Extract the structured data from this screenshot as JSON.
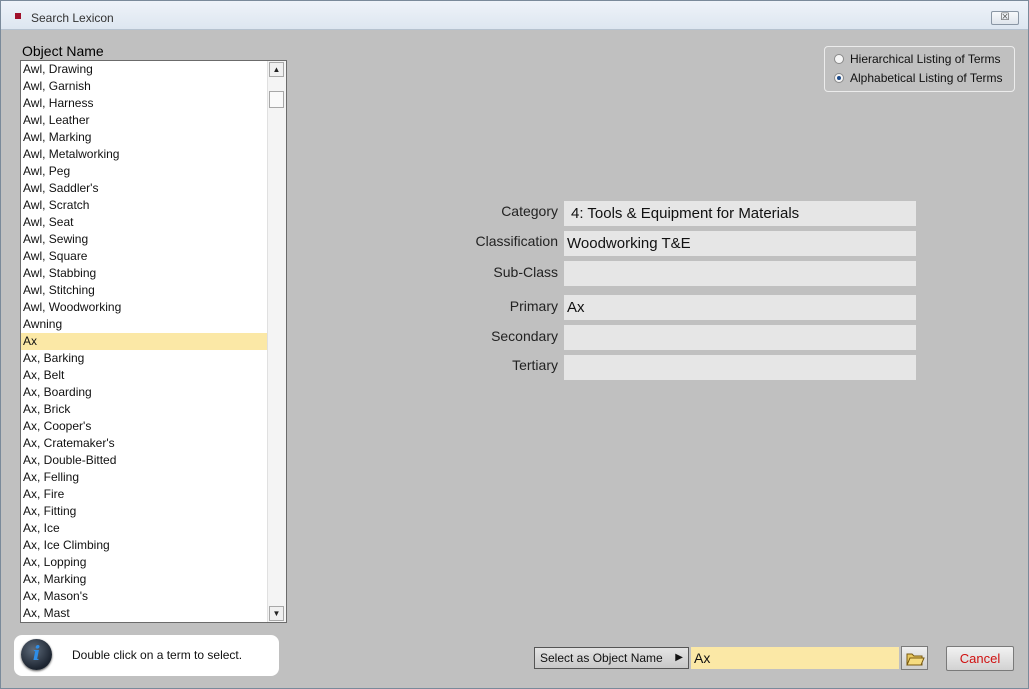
{
  "window": {
    "title": "Search Lexicon",
    "close_label": "☒"
  },
  "list": {
    "header": "Object Name",
    "items": [
      "Awl, Drawing",
      "Awl, Garnish",
      "Awl, Harness",
      "Awl, Leather",
      "Awl, Marking",
      "Awl, Metalworking",
      "Awl, Peg",
      "Awl, Saddler's",
      "Awl, Scratch",
      "Awl, Seat",
      "Awl, Sewing",
      "Awl, Square",
      "Awl, Stabbing",
      "Awl, Stitching",
      "Awl, Woodworking",
      "Awning",
      "Ax",
      "Ax, Barking",
      "Ax, Belt",
      "Ax, Boarding",
      "Ax, Brick",
      "Ax, Cooper's",
      "Ax, Cratemaker's",
      "Ax, Double-Bitted",
      "Ax, Felling",
      "Ax, Fire",
      "Ax, Fitting",
      "Ax, Ice",
      "Ax, Ice Climbing",
      "Ax, Lopping",
      "Ax, Marking",
      "Ax, Mason's",
      "Ax, Mast"
    ],
    "selected_item": "Ax"
  },
  "view_mode": {
    "options": [
      "Hierarchical Listing of Terms",
      "Alphabetical Listing of Terms"
    ],
    "selected": "Alphabetical Listing of Terms"
  },
  "fields": {
    "category": {
      "label": "Category",
      "value": "4: Tools & Equipment for Materials"
    },
    "classification": {
      "label": "Classification",
      "value": "Woodworking T&E"
    },
    "subclass": {
      "label": "Sub-Class",
      "value": ""
    },
    "primary": {
      "label": "Primary",
      "value": "Ax"
    },
    "secondary": {
      "label": "Secondary",
      "value": ""
    },
    "tertiary": {
      "label": "Tertiary",
      "value": ""
    }
  },
  "info": {
    "text": "Double click on a term to select."
  },
  "footer": {
    "select_button": "Select as Object Name",
    "object_name_value": "Ax",
    "cancel_button": "Cancel"
  },
  "colors": {
    "selection_highlight": "#fbe8a6",
    "cancel_text": "#d01010",
    "background": "#c0c0c0"
  }
}
